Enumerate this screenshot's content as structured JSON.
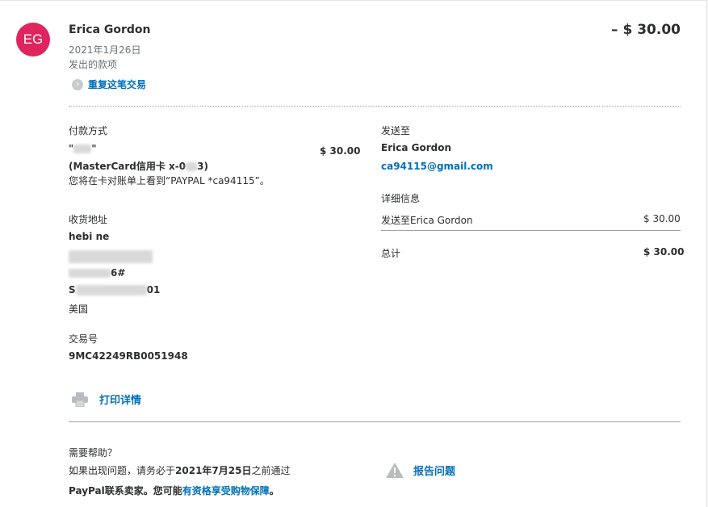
{
  "header": {
    "avatar_initials": "EG",
    "name": "Erica Gordon",
    "date": "2021年1月26日",
    "type": "发出的款项",
    "amount": "– $ 30.00",
    "repeat_label": "重复这笔交易"
  },
  "payment": {
    "label": "付款方式",
    "source_prefix": "\"",
    "source_suffix": "\"",
    "card_prefix": "(MasterCard信用卡 x-0",
    "card_suffix": "3)",
    "amount": "$ 30.00",
    "statement_note": "您将在卡对账单上看到“PAYPAL *ca94115”。"
  },
  "sent_to": {
    "label": "发送至",
    "name": "Erica Gordon",
    "email": "ca94115@gmail.com"
  },
  "details": {
    "label": "详细信息",
    "line_label": "发送至Erica Gordon",
    "line_amount": "$ 30.00",
    "total_label": "总计",
    "total_amount": "$ 30.00"
  },
  "shipping": {
    "label": "收货地址",
    "line1": "hebi ne",
    "line3_suffix": "6#",
    "line4_prefix": "S",
    "line4_suffix": "01",
    "country": "美国"
  },
  "transaction": {
    "label": "交易号",
    "id": "9MC42249RB0051948"
  },
  "actions": {
    "print_label": "打印详情",
    "report_label": "报告问题"
  },
  "help": {
    "title": "需要帮助？",
    "line1_a": "如果出现问题，请务必于",
    "line1_date": "2021年7月25日",
    "line1_b": "之前通过",
    "line2_a": "PayPal联系卖家。您可能",
    "line2_link": "有资格享受购物保障",
    "line2_b": "。"
  },
  "colors": {
    "accent": "#0070ba",
    "avatar": "#e0245e"
  }
}
